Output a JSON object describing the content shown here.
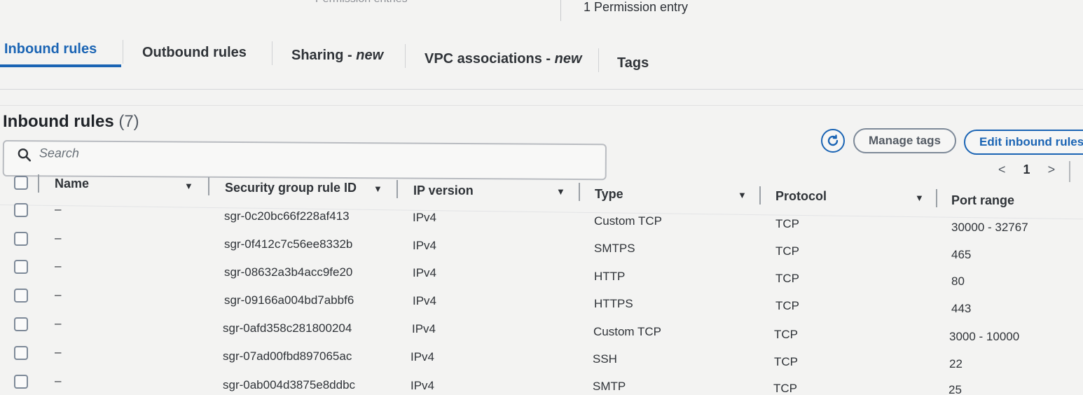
{
  "top": {
    "faded_text": "Permission entries",
    "permission_entry": "1 Permission entry"
  },
  "tabs": [
    {
      "label": "Inbound rules",
      "suffix": "",
      "active": true
    },
    {
      "label": "Outbound rules",
      "suffix": "",
      "active": false
    },
    {
      "label": "Sharing - ",
      "suffix": "new",
      "active": false
    },
    {
      "label": "VPC associations - ",
      "suffix": "new",
      "active": false
    },
    {
      "label": "Tags",
      "suffix": "",
      "active": false
    }
  ],
  "header": {
    "title": "Inbound rules",
    "count": "(7)",
    "manage_tags": "Manage tags",
    "edit_rules": "Edit inbound rules",
    "refresh_icon": "refresh-icon"
  },
  "search": {
    "placeholder": "Search"
  },
  "pagination": {
    "prev": "<",
    "page": "1",
    "next": ">"
  },
  "columns": [
    "Name",
    "Security group rule ID",
    "IP version",
    "Type",
    "Protocol",
    "Port range"
  ],
  "rows": [
    {
      "name": "–",
      "id": "sgr-0c20bc66f228af413",
      "ip": "IPv4",
      "type": "Custom TCP",
      "protocol": "TCP",
      "port": "30000 - 32767"
    },
    {
      "name": "–",
      "id": "sgr-0f412c7c56ee8332b",
      "ip": "IPv4",
      "type": "SMTPS",
      "protocol": "TCP",
      "port": "465"
    },
    {
      "name": "–",
      "id": "sgr-08632a3b4acc9fe20",
      "ip": "IPv4",
      "type": "HTTP",
      "protocol": "TCP",
      "port": "80"
    },
    {
      "name": "–",
      "id": "sgr-09166a004bd7abbf6",
      "ip": "IPv4",
      "type": "HTTPS",
      "protocol": "TCP",
      "port": "443"
    },
    {
      "name": "–",
      "id": "sgr-0afd358c281800204",
      "ip": "IPv4",
      "type": "Custom TCP",
      "protocol": "TCP",
      "port": "3000 - 10000"
    },
    {
      "name": "–",
      "id": "sgr-07ad00fbd897065ac",
      "ip": "IPv4",
      "type": "SSH",
      "protocol": "TCP",
      "port": "22"
    },
    {
      "name": "–",
      "id": "sgr-0ab004d3875e8ddbc",
      "ip": "IPv4",
      "type": "SMTP",
      "protocol": "TCP",
      "port": "25"
    }
  ],
  "colors": {
    "accent": "#1a64b4",
    "text": "#2f3338",
    "muted": "#545b64"
  }
}
